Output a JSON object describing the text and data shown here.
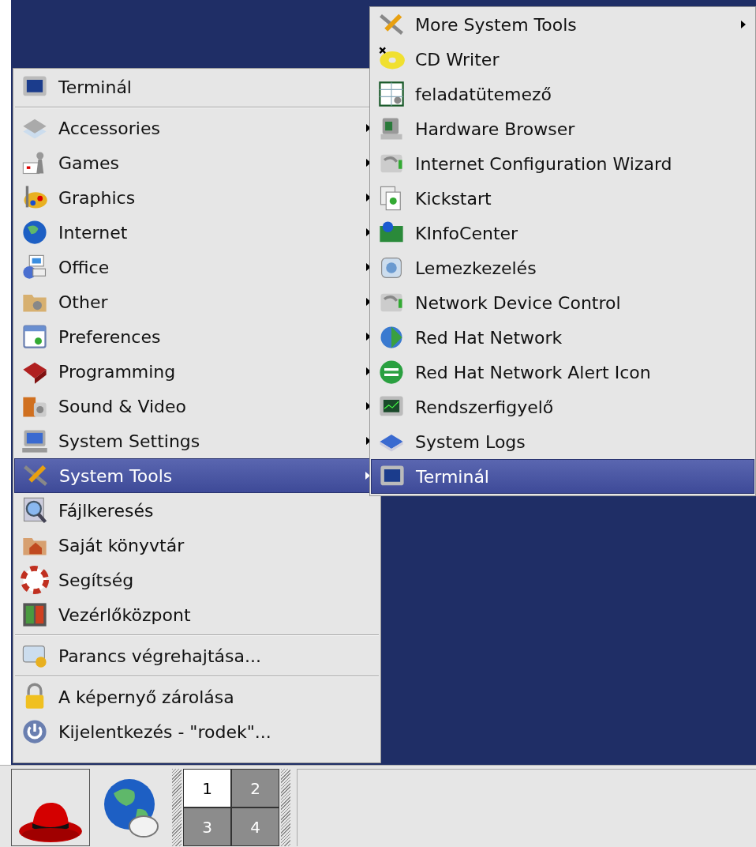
{
  "main_menu": {
    "items": [
      {
        "kind": "item",
        "label": "Terminál",
        "submenu": false,
        "selected": false
      },
      {
        "kind": "separator"
      },
      {
        "kind": "item",
        "label": "Accessories",
        "submenu": true,
        "selected": false
      },
      {
        "kind": "item",
        "label": "Games",
        "submenu": true,
        "selected": false
      },
      {
        "kind": "item",
        "label": "Graphics",
        "submenu": true,
        "selected": false
      },
      {
        "kind": "item",
        "label": "Internet",
        "submenu": true,
        "selected": false
      },
      {
        "kind": "item",
        "label": "Office",
        "submenu": true,
        "selected": false
      },
      {
        "kind": "item",
        "label": "Other",
        "submenu": true,
        "selected": false
      },
      {
        "kind": "item",
        "label": "Preferences",
        "submenu": true,
        "selected": false
      },
      {
        "kind": "item",
        "label": "Programming",
        "submenu": true,
        "selected": false
      },
      {
        "kind": "item",
        "label": "Sound & Video",
        "submenu": true,
        "selected": false
      },
      {
        "kind": "item",
        "label": "System Settings",
        "submenu": true,
        "selected": false
      },
      {
        "kind": "item",
        "label": "System Tools",
        "submenu": true,
        "selected": true
      },
      {
        "kind": "item",
        "label": "Fájlkeresés",
        "submenu": false,
        "selected": false
      },
      {
        "kind": "item",
        "label": "Saját könyvtár",
        "submenu": false,
        "selected": false
      },
      {
        "kind": "item",
        "label": "Segítség",
        "submenu": false,
        "selected": false
      },
      {
        "kind": "item",
        "label": "Vezérlőközpont",
        "submenu": false,
        "selected": false
      },
      {
        "kind": "separator"
      },
      {
        "kind": "item",
        "label": "Parancs végrehajtása...",
        "submenu": false,
        "selected": false
      },
      {
        "kind": "separator"
      },
      {
        "kind": "item",
        "label": "A képernyő zárolása",
        "submenu": false,
        "selected": false
      },
      {
        "kind": "item",
        "label": "Kijelentkezés - \"rodek\"...",
        "submenu": false,
        "selected": false
      }
    ]
  },
  "submenu": {
    "items": [
      {
        "kind": "item",
        "label": "More System Tools",
        "submenu": true,
        "selected": false
      },
      {
        "kind": "item",
        "label": "CD Writer",
        "submenu": false,
        "selected": false
      },
      {
        "kind": "item",
        "label": "feladatütemező",
        "submenu": false,
        "selected": false
      },
      {
        "kind": "item",
        "label": "Hardware Browser",
        "submenu": false,
        "selected": false
      },
      {
        "kind": "item",
        "label": "Internet Configuration Wizard",
        "submenu": false,
        "selected": false
      },
      {
        "kind": "item",
        "label": "Kickstart",
        "submenu": false,
        "selected": false
      },
      {
        "kind": "item",
        "label": "KInfoCenter",
        "submenu": false,
        "selected": false
      },
      {
        "kind": "item",
        "label": "Lemezkezelés",
        "submenu": false,
        "selected": false
      },
      {
        "kind": "item",
        "label": "Network Device Control",
        "submenu": false,
        "selected": false
      },
      {
        "kind": "item",
        "label": "Red Hat Network",
        "submenu": false,
        "selected": false
      },
      {
        "kind": "item",
        "label": "Red Hat Network Alert Icon",
        "submenu": false,
        "selected": false
      },
      {
        "kind": "item",
        "label": "Rendszerfigyelő",
        "submenu": false,
        "selected": false
      },
      {
        "kind": "item",
        "label": "System Logs",
        "submenu": false,
        "selected": false
      },
      {
        "kind": "item",
        "label": "Terminál",
        "submenu": false,
        "selected": true
      }
    ]
  },
  "panel": {
    "workspaces": [
      {
        "label": "1",
        "selected": true
      },
      {
        "label": "2",
        "selected": false
      },
      {
        "label": "3",
        "selected": false
      },
      {
        "label": "4",
        "selected": false
      }
    ]
  }
}
